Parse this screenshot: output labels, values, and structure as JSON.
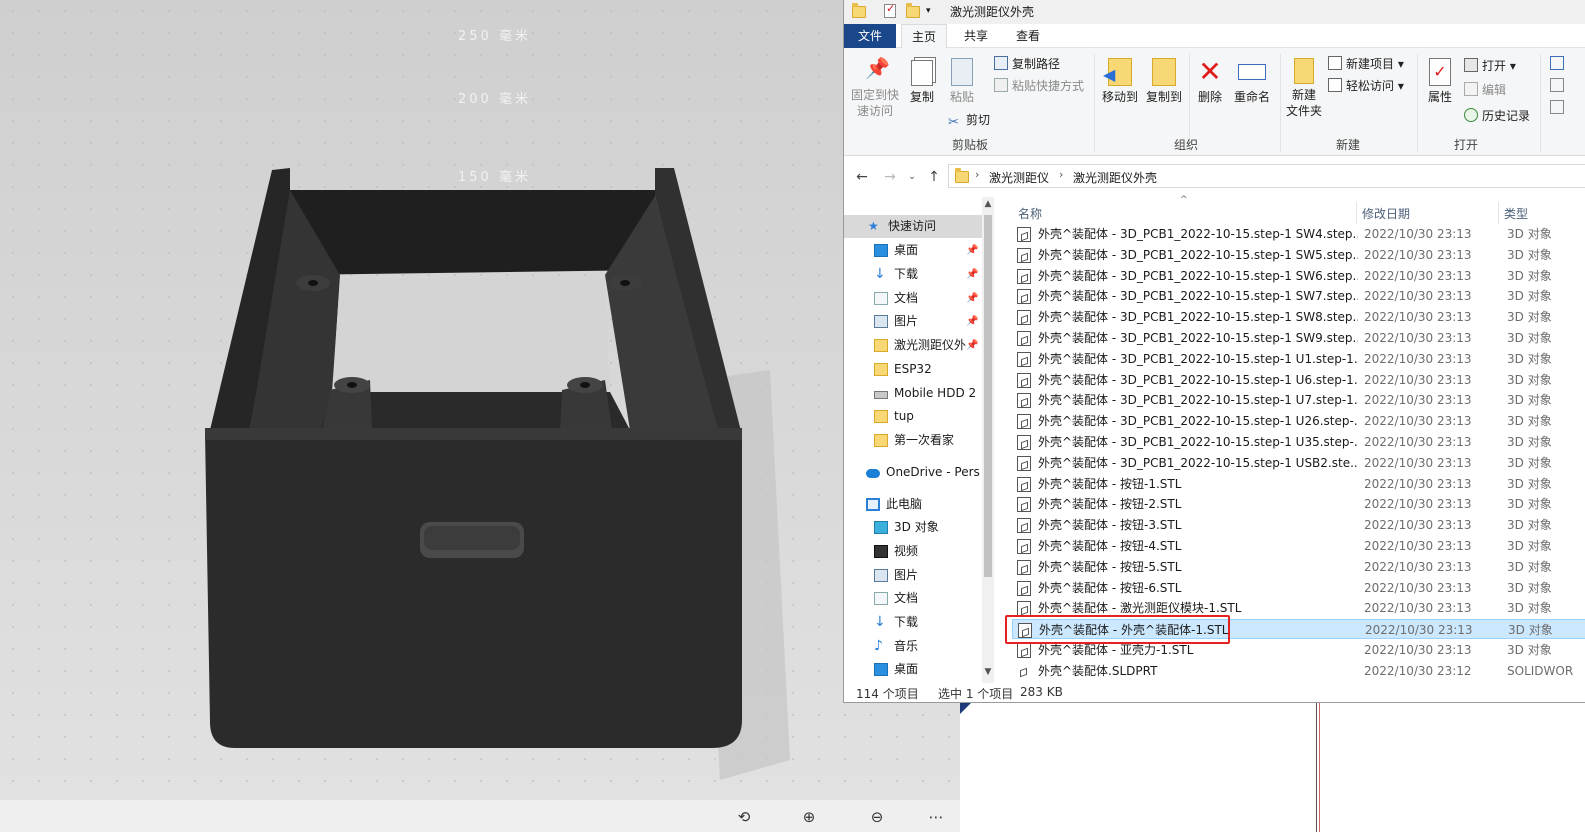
{
  "viewer": {
    "scale_labels": [
      "250 毫米",
      "200 毫米",
      "150 毫米"
    ],
    "tools": [
      "rotate-view-icon",
      "zoom-in-icon",
      "zoom-out-icon",
      "more-icon"
    ]
  },
  "explorer": {
    "window_title": "激光测距仪外壳",
    "tabs": {
      "file": "文件",
      "home": "主页",
      "share": "共享",
      "view": "查看"
    },
    "ribbon": {
      "clipboard": {
        "pin_quick_access": [
          "固定到快",
          "速访问"
        ],
        "copy": "复制",
        "paste": "粘贴",
        "copy_path": "复制路径",
        "paste_shortcut": "粘贴快捷方式",
        "cut": "剪切",
        "group_label": "剪贴板"
      },
      "organize": {
        "move_to": "移动到",
        "copy_to": "复制到",
        "delete": "删除",
        "rename": "重命名",
        "group_label": "组织"
      },
      "new": {
        "new_folder": [
          "新建",
          "文件夹"
        ],
        "new_item": "新建项目",
        "easy_access": "轻松访问",
        "group_label": "新建"
      },
      "open": {
        "properties": "属性",
        "open": "打开",
        "edit": "编辑",
        "history": "历史记录",
        "group_label": "打开"
      }
    },
    "breadcrumb": [
      "激光测距仪",
      "激光测距仪外壳"
    ],
    "nav": [
      {
        "label": "快速访问",
        "icon": "star-icon",
        "pinned": false
      },
      {
        "label": "桌面",
        "icon": "desktop-icon",
        "pinned": true
      },
      {
        "label": "下载",
        "icon": "download-icon",
        "pinned": true
      },
      {
        "label": "文档",
        "icon": "document-icon",
        "pinned": true
      },
      {
        "label": "图片",
        "icon": "picture-icon",
        "pinned": true
      },
      {
        "label": "激光测距仪外",
        "icon": "folder-icon",
        "pinned": true
      },
      {
        "label": "ESP32",
        "icon": "folder-icon",
        "pinned": false
      },
      {
        "label": "Mobile HDD 2",
        "icon": "drive-icon",
        "pinned": false
      },
      {
        "label": "tup",
        "icon": "folder-icon",
        "pinned": false
      },
      {
        "label": "第一次看家",
        "icon": "folder-icon",
        "pinned": false
      },
      {
        "label": "OneDrive - Pers",
        "icon": "cloud-icon",
        "pinned": false
      },
      {
        "label": "此电脑",
        "icon": "computer-icon",
        "pinned": false
      },
      {
        "label": "3D 对象",
        "icon": "cube-icon",
        "pinned": false
      },
      {
        "label": "视频",
        "icon": "video-icon",
        "pinned": false
      },
      {
        "label": "图片",
        "icon": "picture-icon",
        "pinned": false
      },
      {
        "label": "文档",
        "icon": "document-icon",
        "pinned": false
      },
      {
        "label": "下载",
        "icon": "download-icon",
        "pinned": false
      },
      {
        "label": "音乐",
        "icon": "music-icon",
        "pinned": false
      },
      {
        "label": "桌面",
        "icon": "desktop-icon",
        "pinned": false
      }
    ],
    "columns": {
      "name": "名称",
      "date": "修改日期",
      "type": "类型"
    },
    "files": [
      {
        "name": "外壳^装配体 - 3D_PCB1_2022-10-15.step-1 SW4.step...",
        "date": "2022/10/30 23:13",
        "type": "3D 对象"
      },
      {
        "name": "外壳^装配体 - 3D_PCB1_2022-10-15.step-1 SW5.step...",
        "date": "2022/10/30 23:13",
        "type": "3D 对象"
      },
      {
        "name": "外壳^装配体 - 3D_PCB1_2022-10-15.step-1 SW6.step...",
        "date": "2022/10/30 23:13",
        "type": "3D 对象"
      },
      {
        "name": "外壳^装配体 - 3D_PCB1_2022-10-15.step-1 SW7.step...",
        "date": "2022/10/30 23:13",
        "type": "3D 对象"
      },
      {
        "name": "外壳^装配体 - 3D_PCB1_2022-10-15.step-1 SW8.step...",
        "date": "2022/10/30 23:13",
        "type": "3D 对象"
      },
      {
        "name": "外壳^装配体 - 3D_PCB1_2022-10-15.step-1 SW9.step...",
        "date": "2022/10/30 23:13",
        "type": "3D 对象"
      },
      {
        "name": "外壳^装配体 - 3D_PCB1_2022-10-15.step-1 U1.step-1...",
        "date": "2022/10/30 23:13",
        "type": "3D 对象"
      },
      {
        "name": "外壳^装配体 - 3D_PCB1_2022-10-15.step-1 U6.step-1...",
        "date": "2022/10/30 23:13",
        "type": "3D 对象"
      },
      {
        "name": "外壳^装配体 - 3D_PCB1_2022-10-15.step-1 U7.step-1...",
        "date": "2022/10/30 23:13",
        "type": "3D 对象"
      },
      {
        "name": "外壳^装配体 - 3D_PCB1_2022-10-15.step-1 U26.step-...",
        "date": "2022/10/30 23:13",
        "type": "3D 对象"
      },
      {
        "name": "外壳^装配体 - 3D_PCB1_2022-10-15.step-1 U35.step-...",
        "date": "2022/10/30 23:13",
        "type": "3D 对象"
      },
      {
        "name": "外壳^装配体 - 3D_PCB1_2022-10-15.step-1 USB2.ste...",
        "date": "2022/10/30 23:13",
        "type": "3D 对象"
      },
      {
        "name": "外壳^装配体 - 按钮-1.STL",
        "date": "2022/10/30 23:13",
        "type": "3D 对象"
      },
      {
        "name": "外壳^装配体 - 按钮-2.STL",
        "date": "2022/10/30 23:13",
        "type": "3D 对象"
      },
      {
        "name": "外壳^装配体 - 按钮-3.STL",
        "date": "2022/10/30 23:13",
        "type": "3D 对象"
      },
      {
        "name": "外壳^装配体 - 按钮-4.STL",
        "date": "2022/10/30 23:13",
        "type": "3D 对象"
      },
      {
        "name": "外壳^装配体 - 按钮-5.STL",
        "date": "2022/10/30 23:13",
        "type": "3D 对象"
      },
      {
        "name": "外壳^装配体 - 按钮-6.STL",
        "date": "2022/10/30 23:13",
        "type": "3D 对象"
      },
      {
        "name": "外壳^装配体 - 激光测距仪模块-1.STL",
        "date": "2022/10/30 23:13",
        "type": "3D 对象"
      },
      {
        "name": "外壳^装配体 - 外壳^装配体-1.STL",
        "date": "2022/10/30 23:13",
        "type": "3D 对象",
        "selected": true
      },
      {
        "name": "外壳^装配体 - 亚壳力-1.STL",
        "date": "2022/10/30 23:13",
        "type": "3D 对象"
      },
      {
        "name": "外壳^装配体.SLDPRT",
        "date": "2022/10/30 23:12",
        "type": "SOLIDWOR"
      }
    ],
    "status": {
      "count": "114 个项目",
      "selected": "选中 1 个项目",
      "size": "283 KB"
    }
  },
  "colors": {
    "file_tab": "#19478a",
    "selection": "#cce8ff",
    "highlight_box": "#e52222",
    "model": "#2b2b2b"
  }
}
